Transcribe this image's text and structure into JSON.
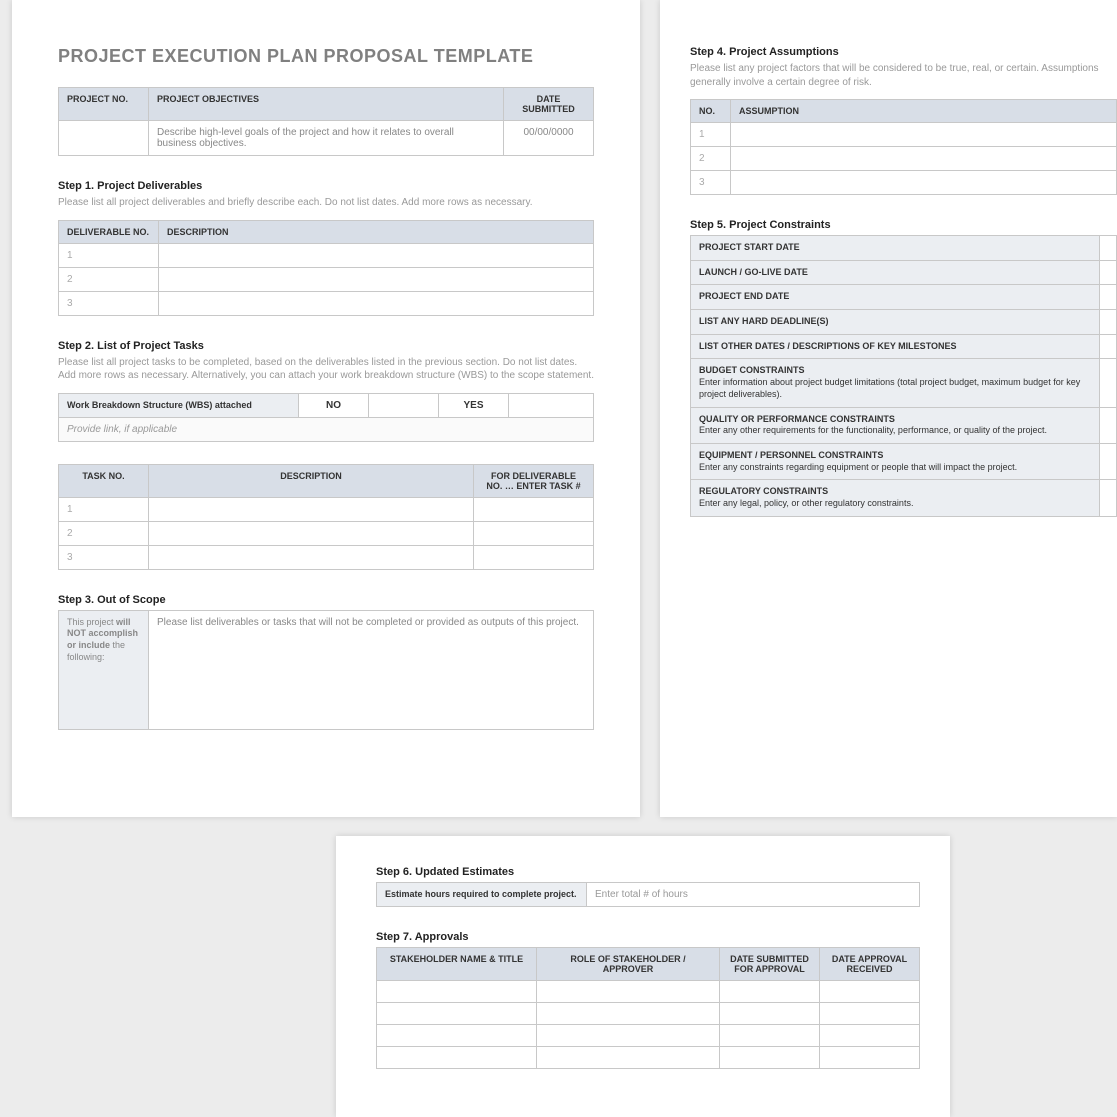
{
  "title": "PROJECT EXECUTION PLAN PROPOSAL TEMPLATE",
  "info": {
    "headers": {
      "projno": "PROJECT NO.",
      "objectives": "PROJECT OBJECTIVES",
      "date": "DATE SUBMITTED"
    },
    "obj_text": "Describe high-level goals of the project and how it relates to overall business objectives.",
    "date_val": "00/00/0000"
  },
  "step1": {
    "title": "Step 1. Project Deliverables",
    "desc": "Please list all project deliverables and briefly describe each. Do not list dates. Add more rows as necessary.",
    "headers": {
      "no": "DELIVERABLE NO.",
      "desc": "DESCRIPTION"
    },
    "rows": [
      "1",
      "2",
      "3"
    ]
  },
  "step2": {
    "title": "Step 2. List of Project Tasks",
    "desc": "Please list all project tasks to be completed, based on the deliverables listed in the previous section. Do not list dates. Add more rows as necessary. Alternatively, you can attach your work breakdown structure (WBS) to the scope statement.",
    "wbs_label": "Work Breakdown Structure (WBS) attached",
    "wbs_no": "NO",
    "wbs_yes": "YES",
    "wbs_link": "Provide link, if applicable",
    "headers": {
      "no": "TASK NO.",
      "desc": "DESCRIPTION",
      "deliv": "FOR DELIVERABLE NO. … ENTER TASK #"
    },
    "rows": [
      "1",
      "2",
      "3"
    ]
  },
  "step3": {
    "title": "Step 3. Out of Scope",
    "left_html": "This project <b>will NOT accomplish or include</b> the following:",
    "right": "Please list deliverables or tasks that will not be completed or provided as outputs of this project."
  },
  "step4": {
    "title": "Step 4. Project Assumptions",
    "desc": "Please list any project factors that will be considered to be true, real, or certain. Assumptions generally involve a certain degree of risk.",
    "headers": {
      "no": "NO.",
      "assumption": "ASSUMPTION"
    },
    "rows": [
      "1",
      "2",
      "3"
    ]
  },
  "step5": {
    "title": "Step 5. Project Constraints",
    "rows": [
      {
        "label": "PROJECT START DATE",
        "sub": ""
      },
      {
        "label": "LAUNCH / GO-LIVE DATE",
        "sub": ""
      },
      {
        "label": "PROJECT END DATE",
        "sub": ""
      },
      {
        "label": "LIST ANY HARD DEADLINE(S)",
        "sub": ""
      },
      {
        "label": "LIST OTHER DATES / DESCRIPTIONS OF KEY MILESTONES",
        "sub": ""
      },
      {
        "label": "BUDGET CONSTRAINTS",
        "sub": "Enter information about project budget limitations (total project budget, maximum budget for key project deliverables)."
      },
      {
        "label": "QUALITY OR PERFORMANCE CONSTRAINTS",
        "sub": "Enter any other requirements for the functionality, performance, or quality of the project."
      },
      {
        "label": "EQUIPMENT / PERSONNEL CONSTRAINTS",
        "sub": "Enter any constraints regarding equipment or people that will impact the project."
      },
      {
        "label": "REGULATORY CONSTRAINTS",
        "sub": "Enter any legal, policy, or other regulatory constraints."
      }
    ]
  },
  "step6": {
    "title": "Step 6. Updated Estimates",
    "label": "Estimate hours required to complete project.",
    "placeholder": "Enter total # of hours"
  },
  "step7": {
    "title": "Step 7. Approvals",
    "headers": {
      "name": "STAKEHOLDER NAME & TITLE",
      "role": "ROLE OF STAKEHOLDER / APPROVER",
      "submitted": "DATE SUBMITTED FOR APPROVAL",
      "received": "DATE APPROVAL RECEIVED"
    }
  }
}
